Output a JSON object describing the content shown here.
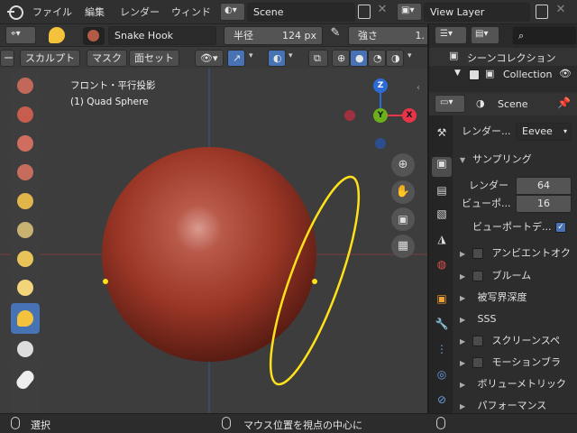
{
  "topbar": {
    "menus": [
      "ファイル",
      "編集",
      "レンダー",
      "ウィンド"
    ],
    "scene_value": "Scene",
    "view_layer_value": "View Layer"
  },
  "tool_header": {
    "brush_name": "Snake Hook",
    "radius_label": "半径",
    "radius_value": "124 px",
    "strength_label": "強さ",
    "strength_value": "1."
  },
  "sub_header": {
    "items": [
      "ー",
      "スカルプト",
      "マスク",
      "面セット"
    ]
  },
  "viewport": {
    "view_name": "フロント・平行投影",
    "object_name": "(1) Quad Sphere",
    "gizmo": {
      "z": "Z",
      "y": "Y",
      "x": "X"
    }
  },
  "outliner": {
    "scene_collection": "シーンコレクション",
    "collection": "Collection"
  },
  "properties": {
    "header_scene": "Scene",
    "render_engine_label": "レンダー...",
    "render_engine_value": "Eevee",
    "sampling_title": "サンプリング",
    "render_label": "レンダー",
    "render_value": "64",
    "viewport_label": "ビューポ...",
    "viewport_value": "16",
    "viewport_denoise_label": "ビューポートデ...",
    "viewport_denoise_checked": true,
    "sections": [
      {
        "label": "アンビエントオク",
        "checkbox": true
      },
      {
        "label": "ブルーム",
        "checkbox": true
      },
      {
        "label": "被写界深度",
        "checkbox": false
      },
      {
        "label": "SSS",
        "checkbox": false
      },
      {
        "label": "スクリーンスペ",
        "checkbox": true
      },
      {
        "label": "モーションブラ",
        "checkbox": true
      },
      {
        "label": "ボリューメトリック",
        "checkbox": false
      },
      {
        "label": "パフォーマンス",
        "checkbox": false
      }
    ]
  },
  "statusbar": {
    "left_label": "選択",
    "center_label": "マウス位置を視点の中心に"
  },
  "colors": {
    "accent_blue": "#4772b3",
    "sphere": "#a8402f",
    "brush_circle": "#ffe11a",
    "axis_x": "#e63448",
    "axis_y": "#6bb01a",
    "axis_z": "#2b6cd8"
  }
}
